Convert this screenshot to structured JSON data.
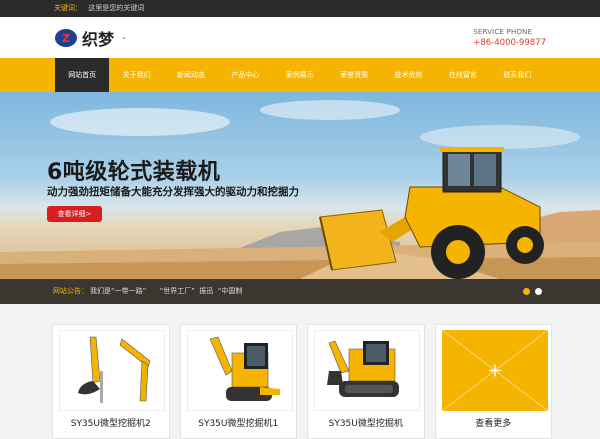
{
  "topbar": {
    "keyword_label": "关键词：",
    "keyword_text": "这里是您的关键词"
  },
  "header": {
    "logo_mark": "Z",
    "logo_text": "织梦",
    "logo_suffix": "-",
    "service_label": "SERVICE PHONE",
    "service_phone": "+86-4000-99877"
  },
  "nav": {
    "items": [
      {
        "label": "网站首页"
      },
      {
        "label": "关于我们"
      },
      {
        "label": "新闻动态"
      },
      {
        "label": "产品中心"
      },
      {
        "label": "案例展示"
      },
      {
        "label": "荣誉资质"
      },
      {
        "label": "技术优势"
      },
      {
        "label": "在线留言"
      },
      {
        "label": "联系我们"
      }
    ]
  },
  "banner": {
    "title": "6吨级轮式装载机",
    "subtitle": "动力强劲扭矩储备大能充分发挥强大的驱动力和挖掘力",
    "button": "查看详细>"
  },
  "notice": {
    "label": "网站公告：",
    "text": "我们是“一带一路”      “世界工厂”  振迅  “中国制"
  },
  "products": [
    {
      "name": "SY35U微型挖掘机2"
    },
    {
      "name": "SY35U微型挖掘机1"
    },
    {
      "name": "SY35U微型挖掘机"
    },
    {
      "name": "查看更多"
    }
  ],
  "colors": {
    "accent": "#f5b400",
    "dark": "#2b2b2b",
    "red": "#d61f1f"
  }
}
